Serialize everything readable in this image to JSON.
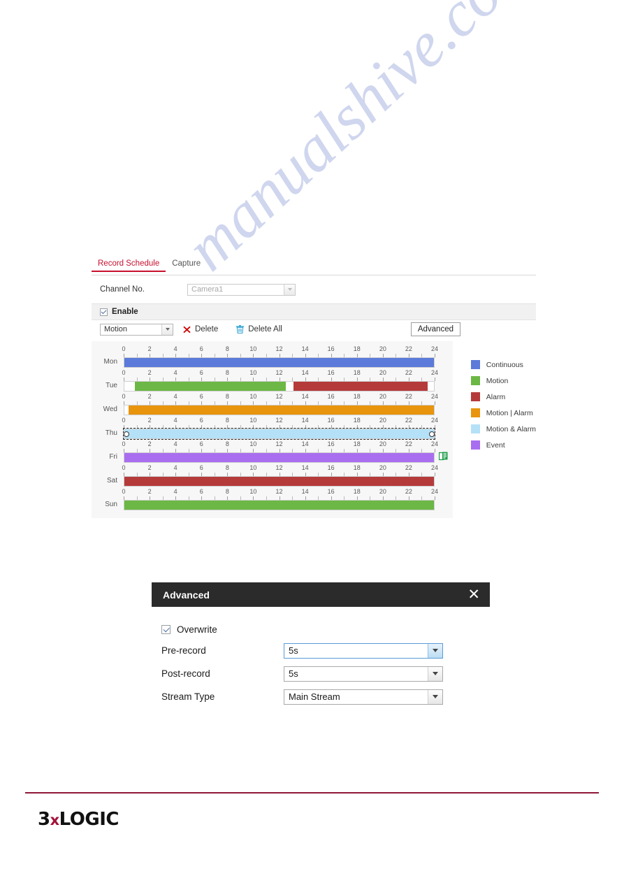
{
  "tabs": [
    {
      "label": "Record Schedule",
      "active": true
    },
    {
      "label": "Capture",
      "active": false
    }
  ],
  "channel": {
    "label": "Channel No.",
    "value": "Camera1",
    "disabled": true
  },
  "enable": {
    "label": "Enable",
    "checked": true
  },
  "toolbar": {
    "type_value": "Motion",
    "delete_label": "Delete",
    "delete_all_label": "Delete All",
    "advanced_label": "Advanced"
  },
  "schedule": {
    "axis_ticks": [
      0,
      2,
      4,
      6,
      8,
      10,
      12,
      14,
      16,
      18,
      20,
      22,
      24
    ],
    "axis_min": 0,
    "axis_max": 24,
    "days": [
      {
        "day": "Mon",
        "selected": false,
        "copy_icon": false,
        "segments": [
          {
            "type": "Continuous",
            "start": 0.0,
            "end": 24.0,
            "color": "#5b7ad9"
          }
        ]
      },
      {
        "day": "Tue",
        "selected": false,
        "copy_icon": false,
        "segments": [
          {
            "type": "Motion",
            "start": 0.8,
            "end": 12.5,
            "color": "#6cb745"
          },
          {
            "type": "Alarm",
            "start": 13.1,
            "end": 23.5,
            "color": "#b53b3b"
          }
        ]
      },
      {
        "day": "Wed",
        "selected": false,
        "copy_icon": false,
        "segments": [
          {
            "type": "Motion | Alarm",
            "start": 0.3,
            "end": 24.0,
            "color": "#e8940d"
          }
        ]
      },
      {
        "day": "Thu",
        "selected": true,
        "copy_icon": false,
        "segments": [
          {
            "type": "Motion & Alarm",
            "start": 0.0,
            "end": 24.0,
            "color": "#b4e1f7"
          }
        ]
      },
      {
        "day": "Fri",
        "selected": false,
        "copy_icon": true,
        "segments": [
          {
            "type": "Event",
            "start": 0.0,
            "end": 24.0,
            "color": "#a96ef0"
          }
        ]
      },
      {
        "day": "Sat",
        "selected": false,
        "copy_icon": false,
        "segments": [
          {
            "type": "Alarm",
            "start": 0.0,
            "end": 24.0,
            "color": "#b53b3b"
          }
        ]
      },
      {
        "day": "Sun",
        "selected": false,
        "copy_icon": false,
        "segments": [
          {
            "type": "Motion",
            "start": 0.0,
            "end": 24.0,
            "color": "#6cb745"
          }
        ]
      }
    ]
  },
  "legend": [
    {
      "label": "Continuous",
      "color": "#5b7ad9"
    },
    {
      "label": "Motion",
      "color": "#6cb745"
    },
    {
      "label": "Alarm",
      "color": "#b53b3b"
    },
    {
      "label": "Motion | Alarm",
      "color": "#e8940d"
    },
    {
      "label": "Motion & Alarm",
      "color": "#b4e1f7"
    },
    {
      "label": "Event",
      "color": "#a96ef0"
    }
  ],
  "advanced_dialog": {
    "title": "Advanced",
    "close_label": "✕",
    "overwrite": {
      "label": "Overwrite",
      "checked": true
    },
    "rows": [
      {
        "label": "Pre-record",
        "value": "5s",
        "focused": true
      },
      {
        "label": "Post-record",
        "value": "5s",
        "focused": false
      },
      {
        "label": "Stream Type",
        "value": "Main Stream",
        "focused": false
      }
    ]
  },
  "footer": {
    "brand_prefix": "3",
    "brand_x": "x",
    "brand_suffix": "LOGIC",
    "rule_color": "#8e1838"
  },
  "watermark": {
    "text": "manualshive.com"
  }
}
